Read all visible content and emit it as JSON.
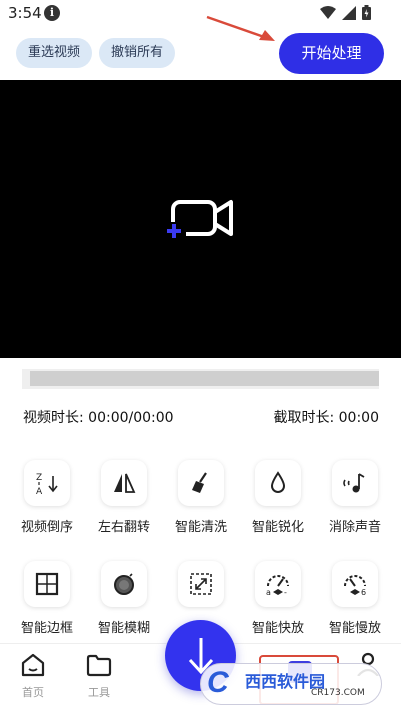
{
  "status_bar": {
    "time": "3:54",
    "info_glyph": "i"
  },
  "top_actions": {
    "reselect_video": "重选视频",
    "undo_all": "撤销所有",
    "start_processing": "开始处理"
  },
  "durations": {
    "video_duration": "视频时长: 00:00/00:00",
    "cut_duration": "截取时长: 00:00"
  },
  "tools": [
    {
      "label": "视频倒序",
      "icon": "reverse-sort-icon"
    },
    {
      "label": "左右翻转",
      "icon": "flip-horizontal-icon"
    },
    {
      "label": "智能清洗",
      "icon": "broom-icon"
    },
    {
      "label": "智能锐化",
      "icon": "droplet-icon"
    },
    {
      "label": "消除声音",
      "icon": "mute-music-icon"
    },
    {
      "label": "智能边框",
      "icon": "border-grid-icon"
    },
    {
      "label": "智能模糊",
      "icon": "blur-circle-icon"
    },
    {
      "label": "",
      "icon": "expand-icon"
    },
    {
      "label": "智能快放",
      "icon": "speed-up-gauge-icon"
    },
    {
      "label": "智能慢放",
      "icon": "slow-down-gauge-icon"
    }
  ],
  "bottom_nav": {
    "home": "首页",
    "tools": "工具"
  },
  "watermark": {
    "logo": "C",
    "brand": "西西软件园",
    "url": "CR173.COM"
  },
  "colors": {
    "accent": "#2f2fe6",
    "chip_bg": "#dbe8f6",
    "annotation": "#d94a3a"
  }
}
